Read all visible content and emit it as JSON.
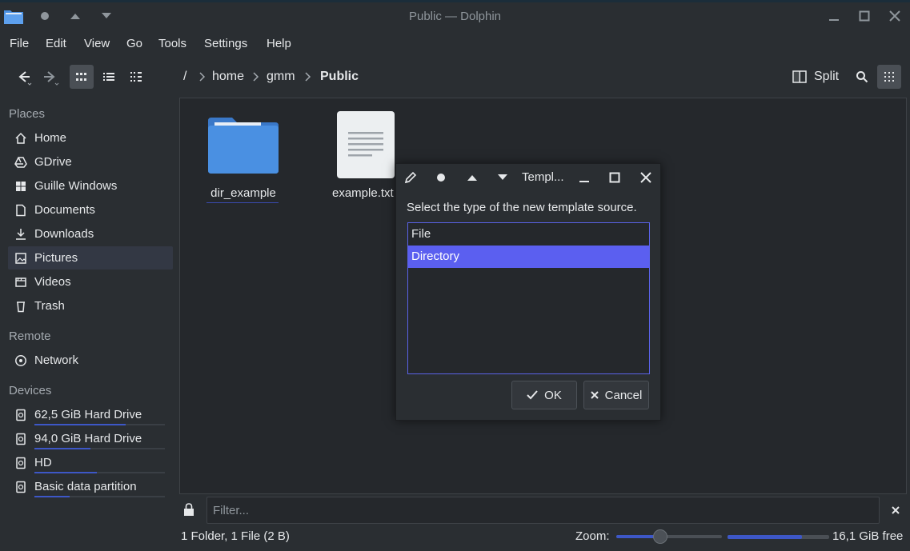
{
  "window": {
    "title": "Public — Dolphin"
  },
  "menu": [
    "File",
    "Edit",
    "View",
    "Go",
    "Tools",
    "Settings",
    "Help"
  ],
  "breadcrumb": {
    "root": "/",
    "items": [
      "home",
      "gmm",
      "Public"
    ]
  },
  "toolbar": {
    "split_label": "Split"
  },
  "sidebar": {
    "places_header": "Places",
    "places": [
      "Home",
      "GDrive",
      "Guille Windows",
      "Documents",
      "Downloads",
      "Pictures",
      "Videos",
      "Trash"
    ],
    "remote_header": "Remote",
    "remote": [
      "Network"
    ],
    "devices_header": "Devices",
    "devices": [
      {
        "label": "62,5 GiB Hard Drive",
        "usage": 0.7
      },
      {
        "label": "94,0 GiB Hard Drive",
        "usage": 0.43
      },
      {
        "label": "HD",
        "usage": 0.48
      },
      {
        "label": "Basic data partition",
        "usage": 0.27
      }
    ]
  },
  "files": [
    "dir_example",
    "example.txt"
  ],
  "dialog": {
    "title": "Templ...",
    "message": "Select the type of the new template source.",
    "options": [
      "File",
      "Directory"
    ],
    "selected": "Directory",
    "ok_label": "OK",
    "cancel_label": "Cancel"
  },
  "filter": {
    "placeholder": "Filter..."
  },
  "status": {
    "summary": "1 Folder, 1 File (2 B)",
    "zoom_label": "Zoom:",
    "zoom_level": 0.4,
    "free_fraction": 0.73,
    "free_label": "16,1 GiB free"
  },
  "colors": {
    "accent": "#5b5ff0",
    "folder": "#4a90e2",
    "background": "#2a2e32",
    "view": "#25282c"
  }
}
